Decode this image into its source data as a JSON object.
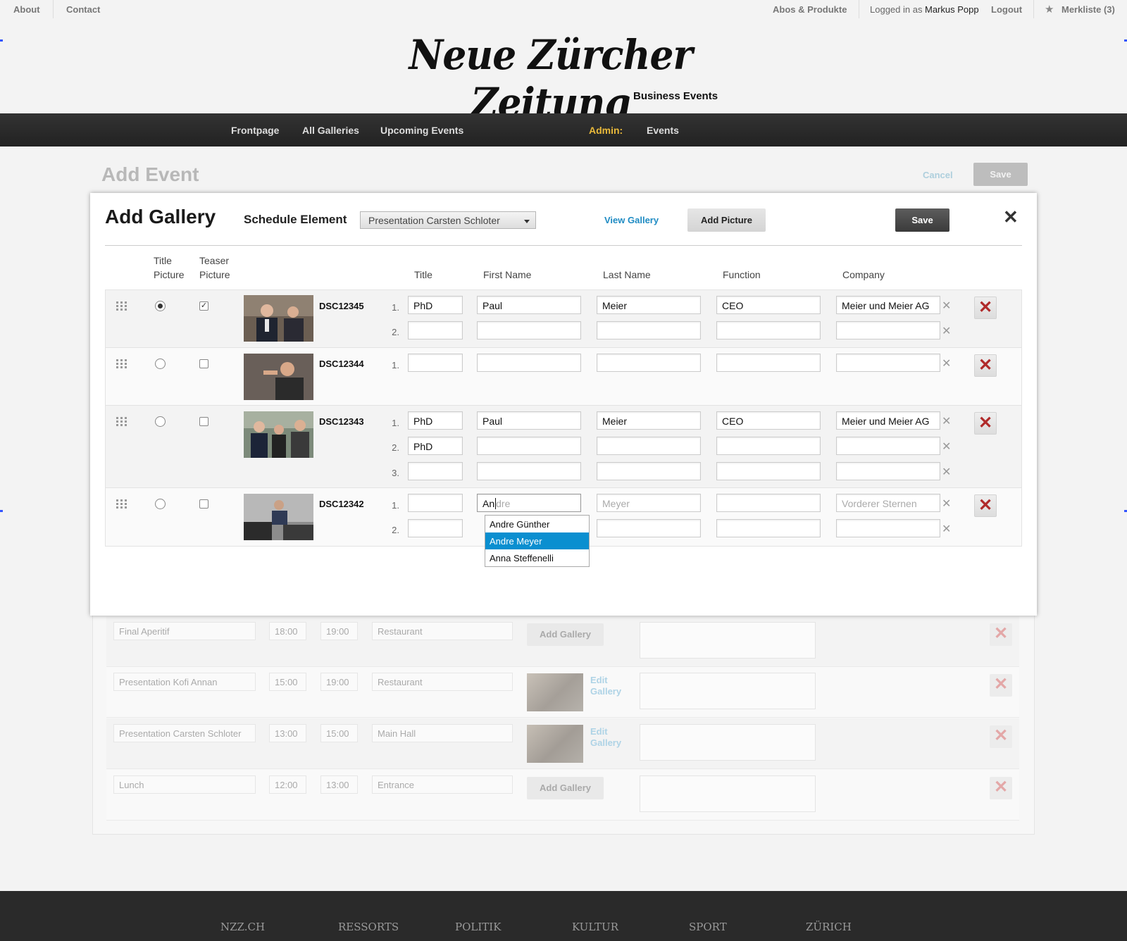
{
  "topbar": {
    "about": "About",
    "contact": "Contact",
    "abos": "Abos & Produkte",
    "logged_in_prefix": "Logged in as",
    "user_name": "Markus Popp",
    "logout": "Logout",
    "merkliste": "Merkliste (3)"
  },
  "masthead": {
    "logo_text": "Neue Zürcher Zeitung",
    "subbrand": "Business Events"
  },
  "nav": {
    "items": [
      "Frontpage",
      "All Galleries",
      "Upcoming Events"
    ],
    "admin_label": "Admin:",
    "admin_items": [
      "Events"
    ]
  },
  "page": {
    "title": "Add Event",
    "cancel": "Cancel",
    "save": "Save"
  },
  "modal": {
    "title": "Add Gallery",
    "schedule_label": "Schedule Element",
    "schedule_selected": "Presentation Carsten Schloter",
    "view_gallery": "View Gallery",
    "add_picture": "Add Picture",
    "save": "Save",
    "columns": {
      "title_picture": [
        "Title",
        "Picture"
      ],
      "teaser_picture": [
        "Teaser",
        "Picture"
      ],
      "title": "Title",
      "first_name": "First Name",
      "last_name": "Last Name",
      "function": "Function",
      "company": "Company"
    },
    "pictures": [
      {
        "id": "DSC12345",
        "title_picture": true,
        "teaser_picture": true,
        "persons": [
          {
            "num": "1.",
            "title": "PhD",
            "first": "Paul",
            "last": "Meier",
            "function": "CEO",
            "company": "Meier und Meier AG"
          },
          {
            "num": "2.",
            "title": "",
            "first": "",
            "last": "",
            "function": "",
            "company": ""
          }
        ]
      },
      {
        "id": "DSC12344",
        "title_picture": false,
        "teaser_picture": false,
        "persons": [
          {
            "num": "1.",
            "title": "",
            "first": "",
            "last": "",
            "function": "",
            "company": ""
          }
        ]
      },
      {
        "id": "DSC12343",
        "title_picture": false,
        "teaser_picture": false,
        "persons": [
          {
            "num": "1.",
            "title": "PhD",
            "first": "Paul",
            "last": "Meier",
            "function": "CEO",
            "company": "Meier und Meier AG"
          },
          {
            "num": "2.",
            "title": "PhD",
            "first": "",
            "last": "",
            "function": "",
            "company": ""
          },
          {
            "num": "3.",
            "title": "",
            "first": "",
            "last": "",
            "function": "",
            "company": ""
          }
        ]
      },
      {
        "id": "DSC12342",
        "title_picture": false,
        "teaser_picture": false,
        "persons": [
          {
            "num": "1.",
            "title": "",
            "first": "An",
            "first_completion": "dre",
            "last_placeholder": "Meyer",
            "function": "",
            "company_placeholder": "Vorderer Sternen"
          },
          {
            "num": "2.",
            "title": "",
            "first": "",
            "last": "",
            "function": "",
            "company": ""
          }
        ]
      }
    ],
    "autocomplete": [
      "Andre Günther",
      "Andre Meyer",
      "Anna Steffenelli"
    ],
    "autocomplete_selected": "Andre Meyer"
  },
  "schedule": [
    {
      "name": "Final Aperitif",
      "start": "18:00",
      "end": "19:00",
      "location": "Restaurant",
      "gallery_action": "Add Gallery"
    },
    {
      "name": "Presentation Kofi Annan",
      "start": "15:00",
      "end": "19:00",
      "location": "Restaurant",
      "gallery_action": "Edit Gallery"
    },
    {
      "name": "Presentation Carsten Schloter",
      "start": "13:00",
      "end": "15:00",
      "location": "Main Hall",
      "gallery_action": "Edit Gallery"
    },
    {
      "name": "Lunch",
      "start": "12:00",
      "end": "13:00",
      "location": "Entrance",
      "gallery_action": "Add Gallery"
    }
  ],
  "footer": {
    "items": [
      "NZZ.CH",
      "RESSORTS",
      "POLITIK",
      "KULTUR",
      "SPORT",
      "ZÜRICH"
    ]
  },
  "colors": {
    "nav_bg": "#222222",
    "admin_accent": "#e9b93a",
    "link_blue": "#1e8bc3",
    "autocomplete_selected": "#0a8fd0",
    "delete_red": "#b02a2a",
    "footer_bg": "#2a2a2a"
  },
  "icons": [
    "star-icon",
    "drag-handle-icon",
    "close-icon",
    "delete-x-icon",
    "remove-person-icon",
    "dropdown-caret-icon"
  ]
}
